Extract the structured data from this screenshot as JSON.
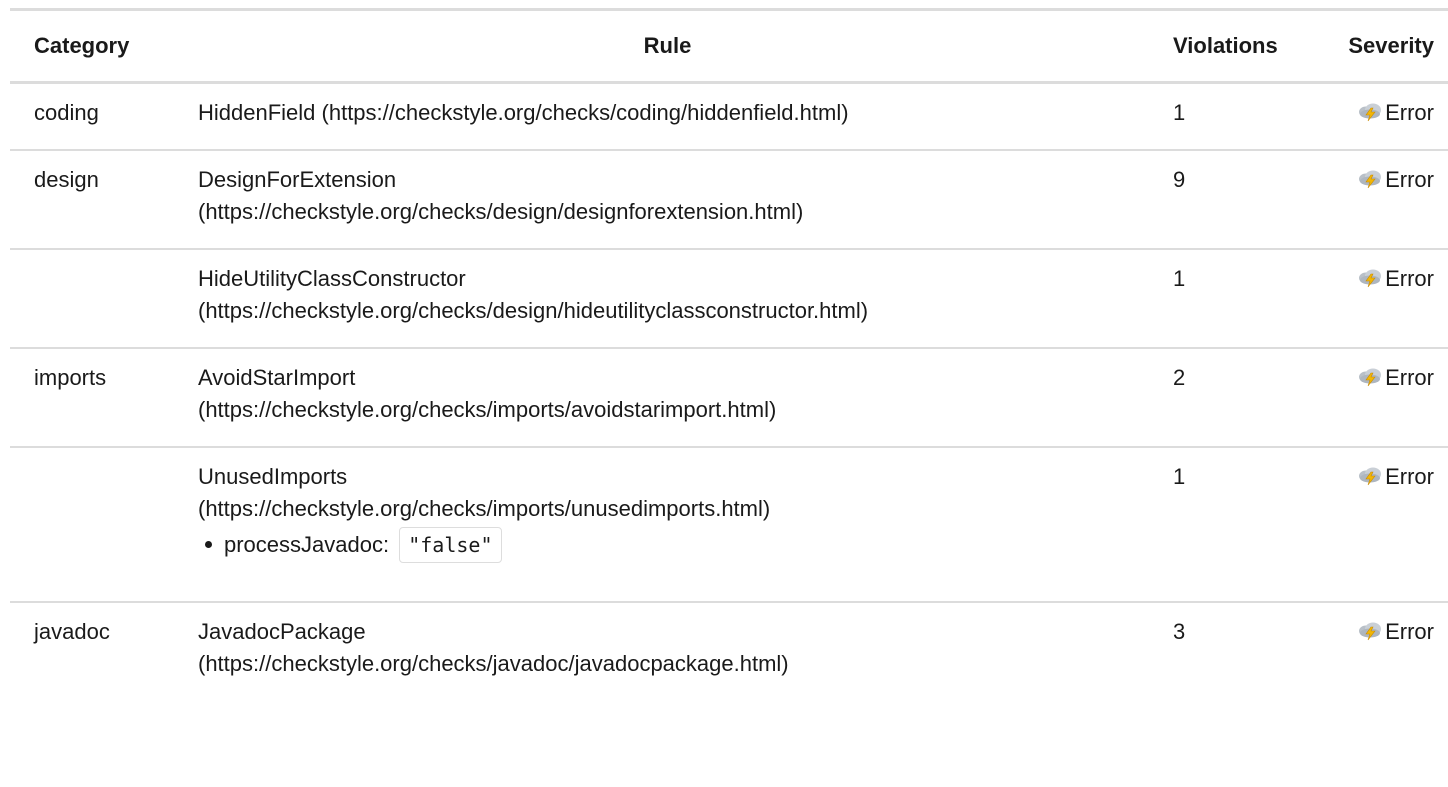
{
  "table": {
    "headers": {
      "category": "Category",
      "rule": "Rule",
      "violations": "Violations",
      "severity": "Severity"
    },
    "rows": [
      {
        "category": "coding",
        "rule_line1": "HiddenField (https://checkstyle.org/checks/coding/hiddenfield.html)",
        "rule_line2": "",
        "violations": "1",
        "severity": "Error"
      },
      {
        "category": "design",
        "rule_line1": "DesignForExtension",
        "rule_line2": "(https://checkstyle.org/checks/design/designforextension.html)",
        "violations": "9",
        "severity": "Error"
      },
      {
        "category": "",
        "rule_line1": "HideUtilityClassConstructor",
        "rule_line2": "(https://checkstyle.org/checks/design/hideutilityclassconstructor.html)",
        "violations": "1",
        "severity": "Error"
      },
      {
        "category": "imports",
        "rule_line1": "AvoidStarImport",
        "rule_line2": "(https://checkstyle.org/checks/imports/avoidstarimport.html)",
        "violations": "2",
        "severity": "Error"
      },
      {
        "category": "",
        "rule_line1": "UnusedImports",
        "rule_line2": "(https://checkstyle.org/checks/imports/unusedimports.html)",
        "property_name": "processJavadoc:",
        "property_value": "\"false\"",
        "violations": "1",
        "severity": "Error"
      },
      {
        "category": "javadoc",
        "rule_line1": "JavadocPackage",
        "rule_line2": "(https://checkstyle.org/checks/javadoc/javadocpackage.html)",
        "violations": "3",
        "severity": "Error"
      }
    ]
  },
  "icons": {
    "severity": "error-storm-cloud-icon"
  },
  "colors": {
    "border": "#dcdcdc",
    "text": "#1a1a1a",
    "cloud": "#b9c0c8",
    "bolt": "#f2b705"
  }
}
